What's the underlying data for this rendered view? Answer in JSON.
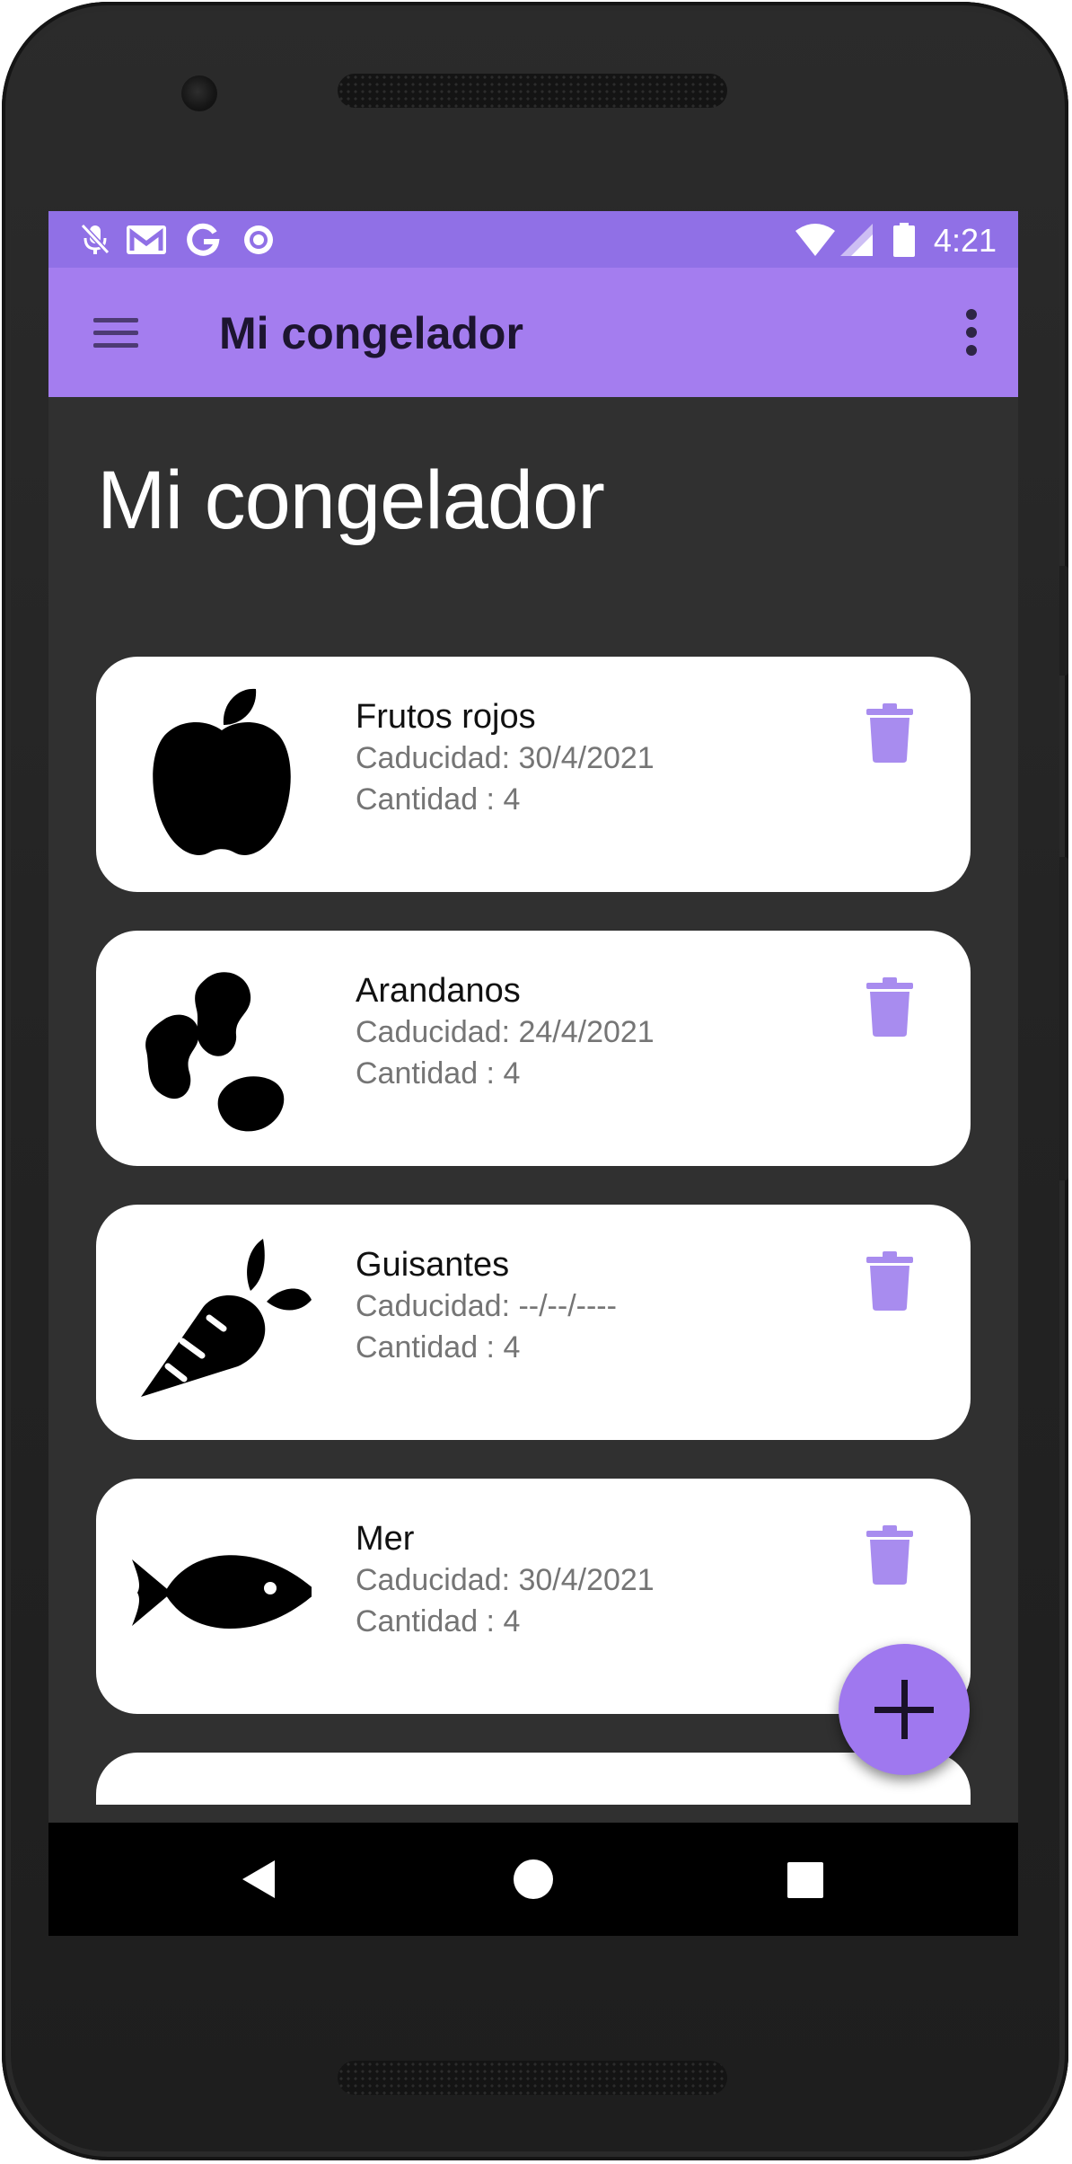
{
  "status_bar": {
    "time": "4:21",
    "left_icons": [
      "mic-muted-icon",
      "gmail-icon",
      "google-icon",
      "circle-notification-icon"
    ],
    "right_icons": [
      "wifi-icon",
      "signal-icon",
      "battery-icon"
    ]
  },
  "app_bar": {
    "title": "Mi congelador",
    "menu_icon": "hamburger-menu-icon",
    "overflow_icon": "more-vert-icon"
  },
  "page": {
    "heading": "Mi congelador"
  },
  "items": [
    {
      "name": "Frutos rojos",
      "expiry": "Caducidad: 30/4/2021",
      "quantity": "Cantidad : 4",
      "icon": "apple-icon"
    },
    {
      "name": "Arandanos",
      "expiry": "Caducidad: 24/4/2021",
      "quantity": "Cantidad : 4",
      "icon": "beans-icon"
    },
    {
      "name": "Guisantes",
      "expiry": "Caducidad: --/--/----",
      "quantity": "Cantidad : 4",
      "icon": "carrot-icon"
    },
    {
      "name": "Mer",
      "expiry": "Caducidad: 30/4/2021",
      "quantity": "Cantidad : 4",
      "icon": "fish-icon"
    }
  ],
  "fab": {
    "icon": "plus-icon"
  },
  "nav_bar": {
    "buttons": [
      "back-icon",
      "home-icon",
      "recents-icon"
    ]
  },
  "colors": {
    "status_bar": "#9070e6",
    "app_bar": "#a47def",
    "background": "#303030",
    "accent": "#9f78ef",
    "trash": "#a88cef"
  }
}
